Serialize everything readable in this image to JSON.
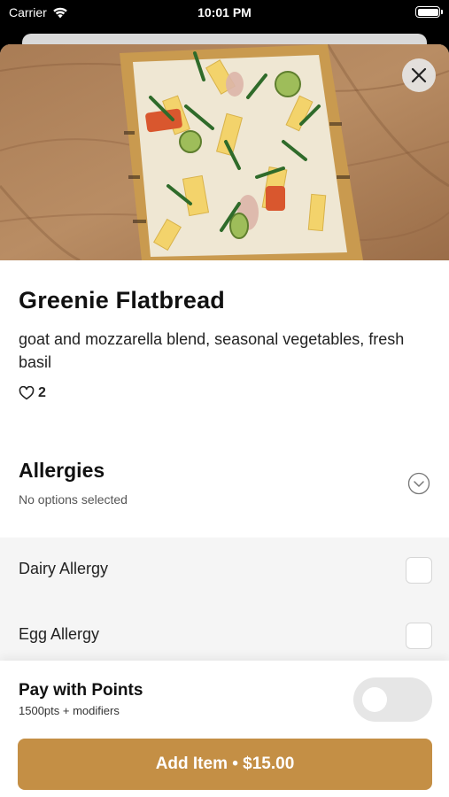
{
  "status_bar": {
    "carrier": "Carrier",
    "time": "10:01 PM"
  },
  "hero": {
    "image_subject": "grilled flatbread with goat and mozzarella, vegetables and basil on wood board"
  },
  "item": {
    "title": "Greenie Flatbread",
    "description": "goat and mozzarella blend, seasonal vegetables, fresh basil",
    "likes": "2"
  },
  "allergies": {
    "title": "Allergies",
    "subtitle": "No options selected",
    "options": [
      {
        "label": "Dairy Allergy"
      },
      {
        "label": "Egg Allergy"
      }
    ]
  },
  "footer": {
    "points_title": "Pay with Points",
    "points_subtitle": "1500pts + modifiers",
    "add_button_label": "Add Item • $15.00"
  },
  "colors": {
    "accent": "#c48f45",
    "toggle_off": "#e6e6e6",
    "list_background": "#f5f5f5"
  },
  "icons": {
    "close": "close-icon",
    "heart": "heart-icon",
    "expand": "chevron-down-circle-icon",
    "wifi": "wifi-icon",
    "battery": "battery-icon"
  }
}
